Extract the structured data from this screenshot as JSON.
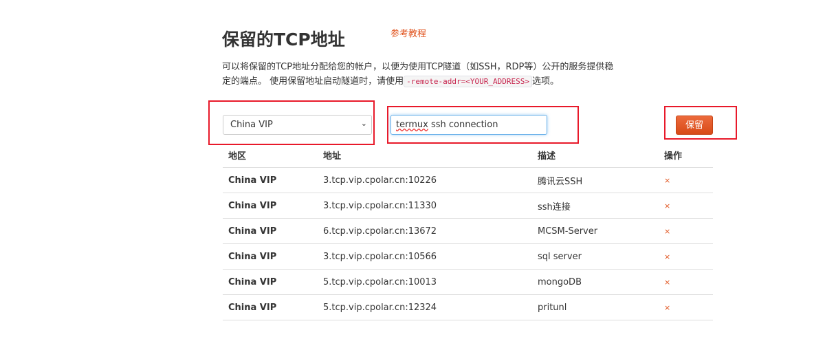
{
  "title": "保留的TCP地址",
  "reference_link": "参考教程",
  "description": {
    "text1": "可以将保留的TCP地址分配给您的帐户，以便为使用TCP隧道（如SSH，RDP等）公开的服务提供稳定的端点。 使用保留地址启动隧道时，请使用",
    "code": "-remote-addr=<YOUR_ADDRESS>",
    "text2": "选项。"
  },
  "form": {
    "region_selected": "China VIP",
    "description_value_misspelled": "termux",
    "description_value_rest": " ssh connection",
    "reserve_button": "保留"
  },
  "table": {
    "headers": [
      "地区",
      "地址",
      "描述",
      "操作"
    ],
    "rows": [
      {
        "region": "China VIP",
        "address": "3.tcp.vip.cpolar.cn:10226",
        "desc": "腾讯云SSH",
        "action": "×"
      },
      {
        "region": "China VIP",
        "address": "3.tcp.vip.cpolar.cn:11330",
        "desc": "ssh连接",
        "action": "×"
      },
      {
        "region": "China VIP",
        "address": "6.tcp.vip.cpolar.cn:13672",
        "desc": "MCSM-Server",
        "action": "×"
      },
      {
        "region": "China VIP",
        "address": "3.tcp.vip.cpolar.cn:10566",
        "desc": "sql server",
        "action": "×"
      },
      {
        "region": "China VIP",
        "address": "5.tcp.vip.cpolar.cn:10013",
        "desc": "mongoDB",
        "action": "×"
      },
      {
        "region": "China VIP",
        "address": "5.tcp.vip.cpolar.cn:12324",
        "desc": "pritunl",
        "action": "×"
      }
    ]
  },
  "colors": {
    "accent": "#e0521c",
    "highlight": "#e8192a"
  }
}
